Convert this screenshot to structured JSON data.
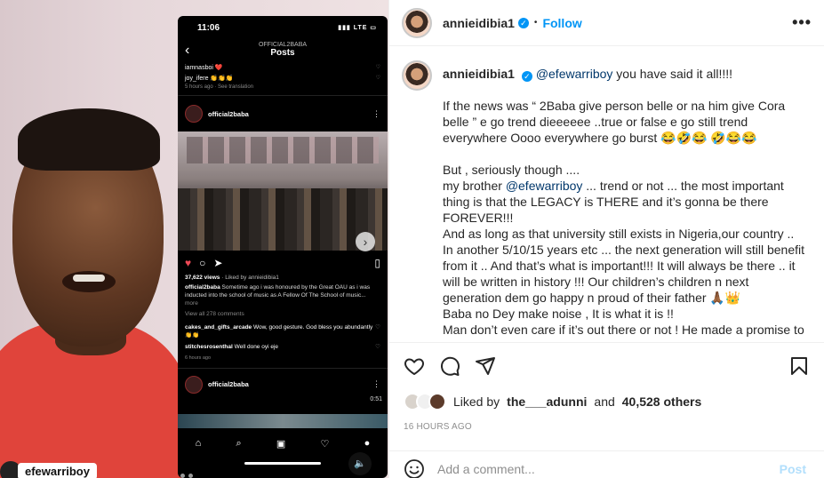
{
  "media": {
    "bottom_username": "efewarriboy",
    "phone": {
      "time": "11:06",
      "network": "LTE",
      "header_sub": "OFFICIAL2BABA",
      "header_title": "Posts",
      "comment1_user": "iamnasboi",
      "comment1_emoji": "❤️",
      "comment2_user": "joy_ifere",
      "comment2_emoji": "👏👏👏",
      "meta": "5 hours ago  ·  See translation",
      "post_username": "official2baba",
      "views": "37,622 views",
      "liked_by": "· Liked by annieidibia1",
      "caption_user": "official2baba",
      "caption_text": "Sometime ago i was honoured by the Great OAU as i was inducted into the school of music as A Fellow Of The School of music...",
      "caption_more": "more",
      "view_all": "View all 278 comments",
      "c1_user": "cakes_and_gifts_arcade",
      "c1_text": "Wow, good gesture. God bless you abundantly 👏👏",
      "c2_user": "stitchesrosenthal",
      "c2_text": "Well done oyi eje",
      "ago": "6 hours ago",
      "post2_username": "official2baba",
      "video_time": "0:51"
    }
  },
  "header": {
    "username": "annieidibia1",
    "separator": "•",
    "follow_label": "Follow",
    "more_label": "•••"
  },
  "caption": {
    "username": "annieidibia1",
    "mention": "@efewarriboy",
    "line1_rest": " you have said it all!!!!",
    "para1": "If the news was “ 2Baba give person belle or na him give Cora belle ” e go trend dieeeeee ..true or false e go still trend everywhere Oooo everywhere go burst 😂🤣😂 🤣😂😂",
    "para2_a": "But , seriously though ....",
    "para2_b_pre": "my brother ",
    "para2_b_mention": "@efewarriboy",
    "para2_b_post": " ... trend or not ... the most important thing is that the LEGACY is THERE and it’s gonna be there FOREVER!!!",
    "para3": "And as long as that university still exists in Nigeria,our country ..\nIn another 5/10/15 years etc ... the next generation will still benefit from it .. And that’s what is important!!! It will always be there .. it will be written in history !!! Our children’s children n next generation dem go happy n proud of their father 🙏🏾👑\nBaba no Dey make noise , It is what it is !!\nMan don’t even care if it’s out there or not ! He made a promise to"
  },
  "likes": {
    "prefix": "Liked by",
    "first_user": "the___adunni",
    "and": "and",
    "others": "40,528 others"
  },
  "timestamp": "16 HOURS AGO",
  "comment": {
    "placeholder": "Add a comment...",
    "post_label": "Post"
  }
}
